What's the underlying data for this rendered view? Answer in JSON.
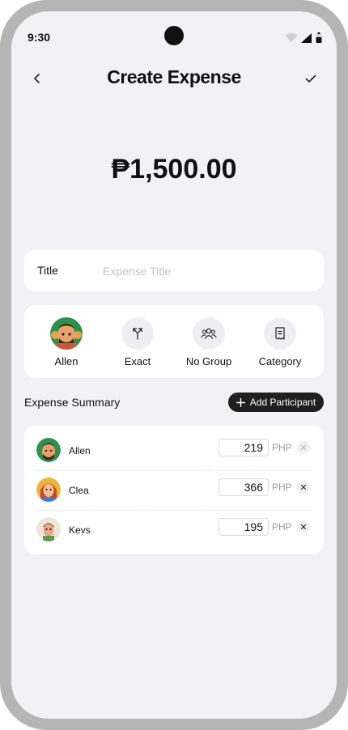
{
  "status_bar": {
    "time": "9:30"
  },
  "header": {
    "title": "Create Expense",
    "back_icon": "chevron-left-icon",
    "confirm_icon": "check-icon"
  },
  "amount": "₱1,500.00",
  "title_field": {
    "label": "Title",
    "placeholder": "Expense Title",
    "value": ""
  },
  "options": [
    {
      "label": "Allen",
      "icon": "avatar"
    },
    {
      "label": "Exact",
      "icon": "split-arrows-icon"
    },
    {
      "label": "No Group",
      "icon": "group-icon"
    },
    {
      "label": "Category",
      "icon": "receipt-icon"
    }
  ],
  "summary": {
    "label": "Expense Summary",
    "add_button_label": "Add Participant",
    "participants": [
      {
        "name": "Allen",
        "amount": "219",
        "currency": "PHP",
        "remove_enabled": false
      },
      {
        "name": "Clea",
        "amount": "366",
        "currency": "PHP",
        "remove_enabled": true
      },
      {
        "name": "Kevs",
        "amount": "195",
        "currency": "PHP",
        "remove_enabled": true
      }
    ]
  },
  "colors": {
    "background": "#f2f2f6",
    "card": "#ffffff",
    "primary_dark": "#1f1f1f",
    "phone_frame": "#b5b5b5",
    "muted_text": "#9a9a9f"
  }
}
